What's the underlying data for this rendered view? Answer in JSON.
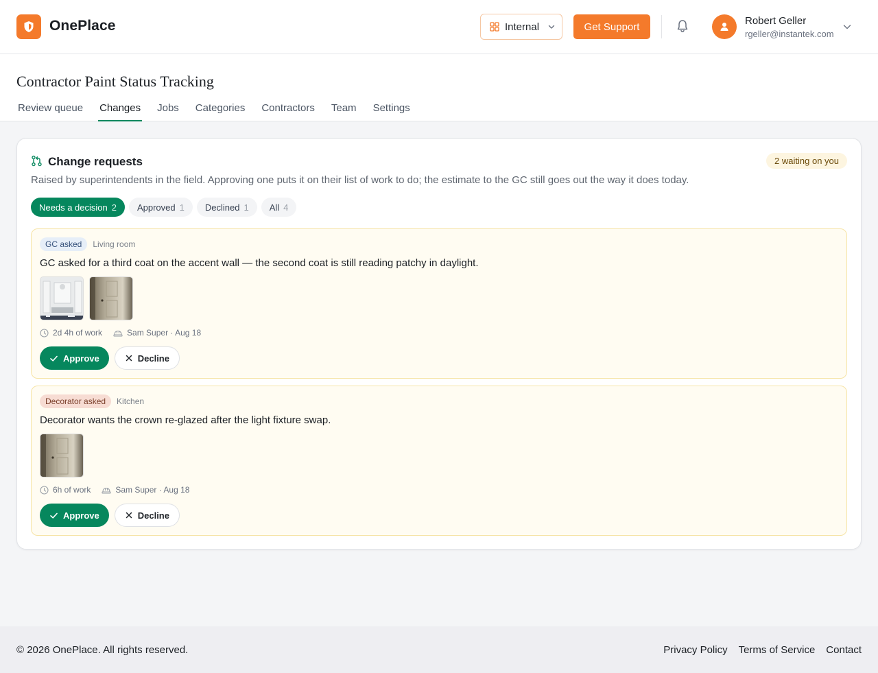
{
  "header": {
    "brand": "OnePlace",
    "workspace": "Internal",
    "support_label": "Get Support",
    "user": {
      "name": "Robert Geller",
      "email": "rgeller@instantek.com"
    }
  },
  "page": {
    "title": "Contractor Paint Status Tracking",
    "tabs": [
      {
        "label": "Review queue"
      },
      {
        "label": "Changes",
        "active": true
      },
      {
        "label": "Jobs"
      },
      {
        "label": "Categories"
      },
      {
        "label": "Contractors"
      },
      {
        "label": "Team"
      },
      {
        "label": "Settings"
      }
    ]
  },
  "changes": {
    "title": "Change requests",
    "waiting_badge": "2 waiting on you",
    "subtitle": "Raised by superintendents in the field. Approving one puts it on their list of work to do; the estimate to the GC still goes out the way it does today.",
    "filters": [
      {
        "label": "Needs a decision",
        "count": "2",
        "active": true
      },
      {
        "label": "Approved",
        "count": "1"
      },
      {
        "label": "Declined",
        "count": "1"
      },
      {
        "label": "All",
        "count": "4"
      }
    ],
    "requests": [
      {
        "tag": "GC asked",
        "room": "Living room",
        "text": "GC asked for a third coat on the accent wall — the second coat is still reading patchy in daylight.",
        "duration": "2d 4h of work",
        "by": "Sam Super · Aug 18",
        "approve_label": "Approve",
        "decline_label": "Decline"
      },
      {
        "tag": "Decorator asked",
        "room": "Kitchen",
        "text": "Decorator wants the crown re-glazed after the light fixture swap.",
        "duration": "6h of work",
        "by": "Sam Super · Aug 18",
        "approve_label": "Approve",
        "decline_label": "Decline"
      }
    ]
  },
  "footer": {
    "copyright": "© 2026 OnePlace. All rights reserved.",
    "links": [
      "Privacy Policy",
      "Terms of Service",
      "Contact"
    ]
  },
  "colors": {
    "brand_orange": "#f47a2b",
    "approve_green": "#06875d",
    "request_bg": "#fffcf2"
  }
}
